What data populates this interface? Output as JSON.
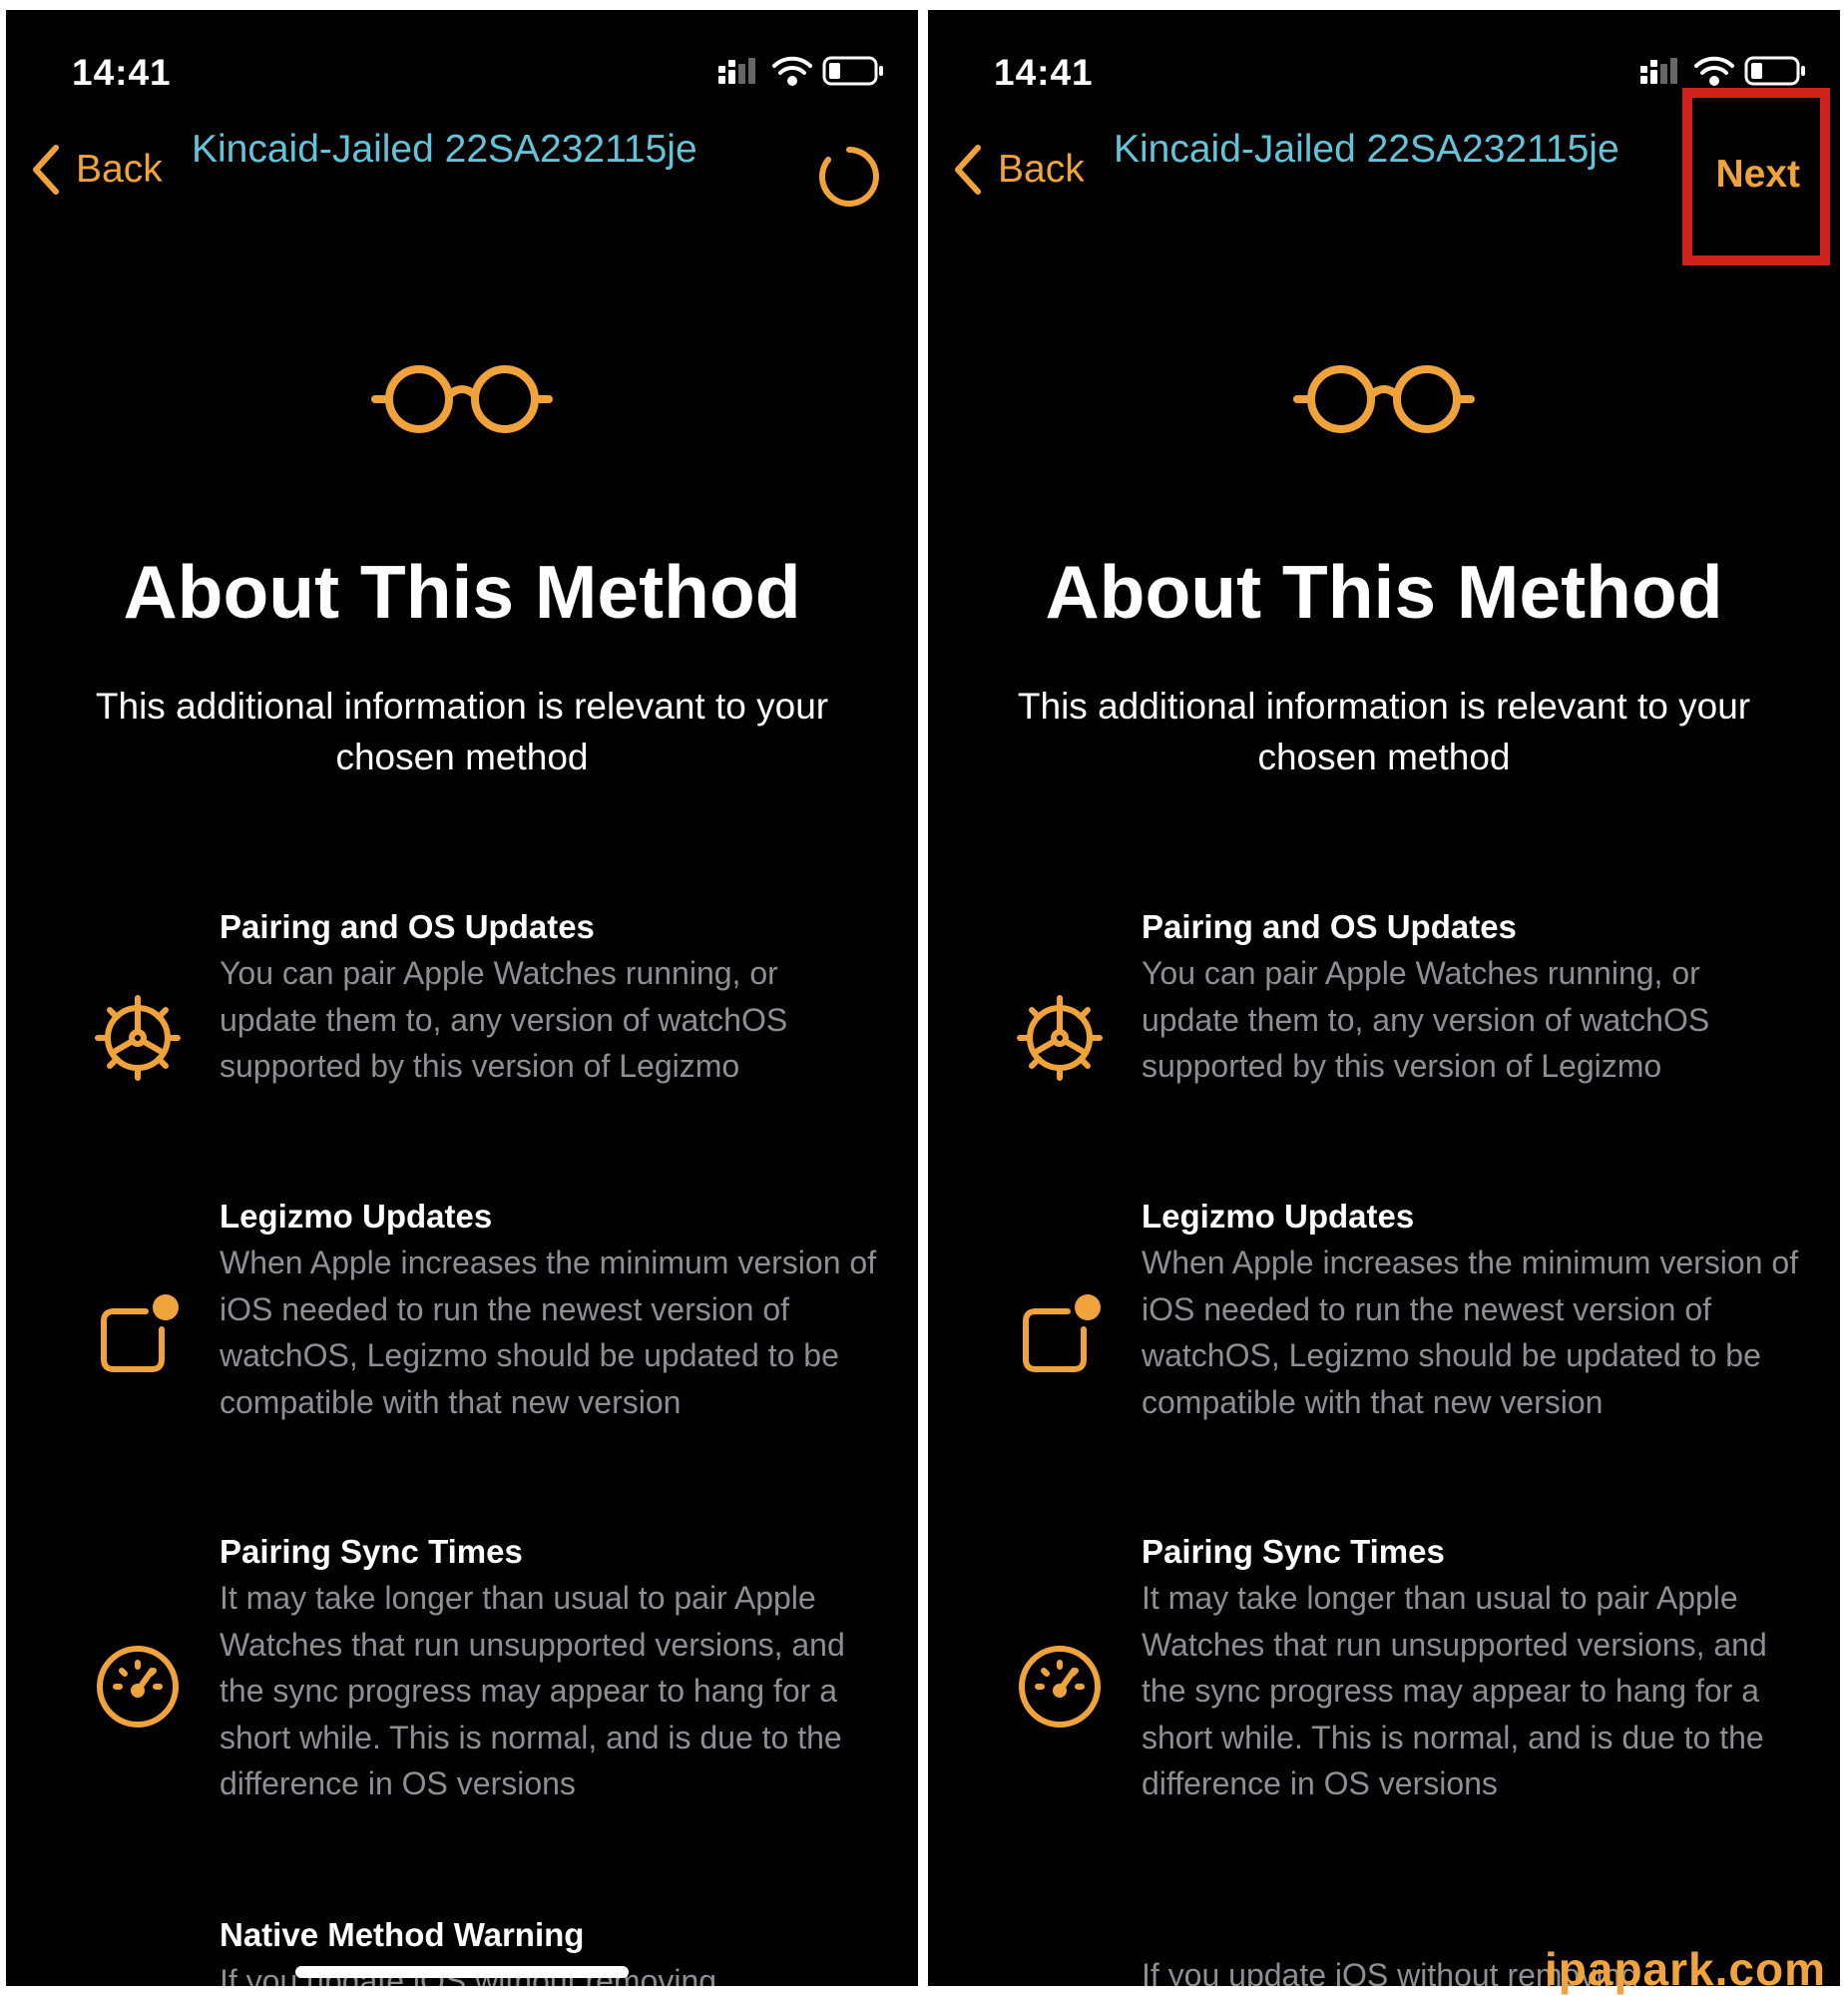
{
  "status": {
    "time": "14:41"
  },
  "nav": {
    "back_label": "Back",
    "title": "Kincaid-Jailed 22SA232115je",
    "next_label": "Next"
  },
  "main": {
    "heading": "About This Method",
    "subtitle": "This additional information is relevant to your chosen method"
  },
  "features": [
    {
      "title": "Pairing and OS Updates",
      "body": "You can pair Apple Watches running, or update them to, any version of watchOS supported by this version of Legizmo",
      "icon": "gear-icon"
    },
    {
      "title": "Legizmo Updates",
      "body": "When Apple increases the minimum version of iOS needed to run the newest version of watchOS, Legizmo should be updated to be compatible with that new version",
      "icon": "app-badge-icon"
    },
    {
      "title": "Pairing Sync Times",
      "body": "It may take longer than usual to pair Apple Watches that run unsupported versions, and the sync progress may appear to hang for a short while. This is normal, and is due to the difference in OS versions",
      "icon": "speedometer-icon"
    },
    {
      "title": "Native Method Warning",
      "body": "If you update iOS without removing",
      "icon": ""
    }
  ],
  "watermark": "ipapark.com",
  "colors": {
    "accent": "#f0a33a",
    "title": "#63c3d9",
    "highlight": "#d0211b",
    "secondary_text": "#8e8e93"
  }
}
